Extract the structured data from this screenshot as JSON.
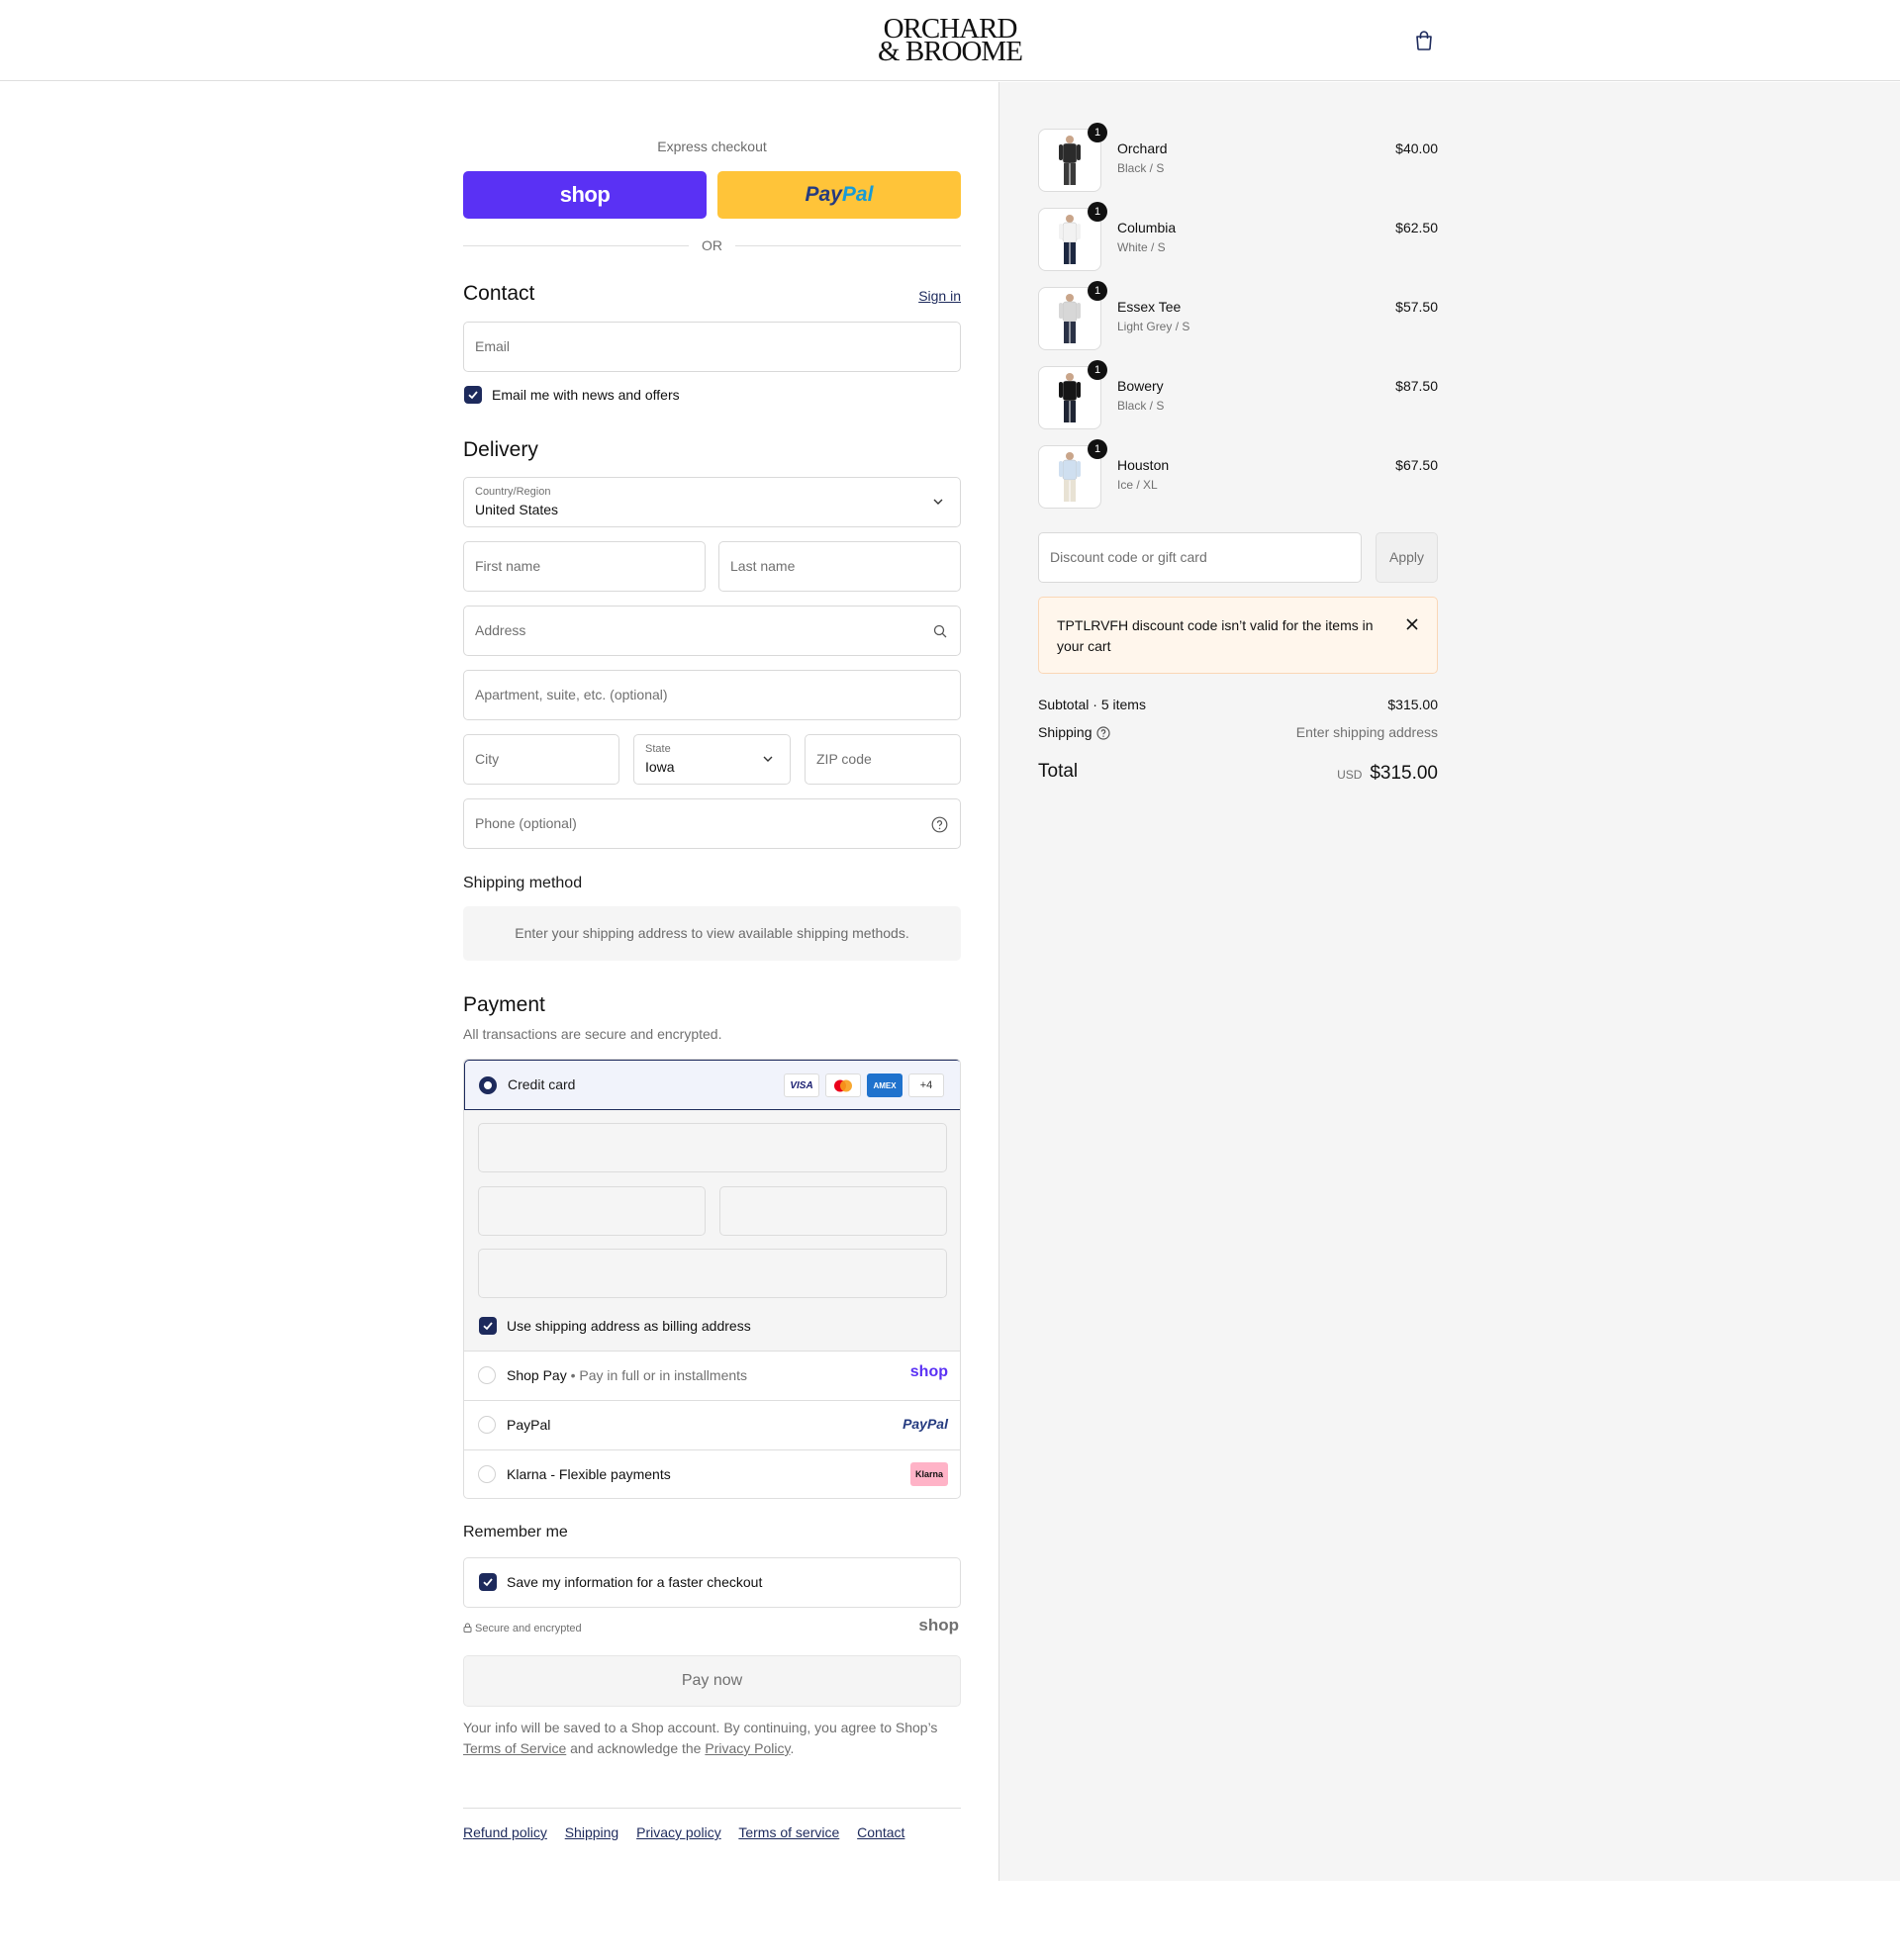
{
  "header": {
    "logo_line1": "ORCHARD",
    "logo_line2": "& BROOME",
    "cart_icon": "shopping-bag-icon"
  },
  "express": {
    "label": "Express checkout",
    "shop_label": "shop",
    "paypal_label_1": "Pay",
    "paypal_label_2": "Pal",
    "or_label": "OR"
  },
  "contact": {
    "title": "Contact",
    "sign_in": "Sign in",
    "email_placeholder": "Email",
    "news_checkbox_label": "Email me with news and offers",
    "news_checked": true
  },
  "delivery": {
    "title": "Delivery",
    "country_label": "Country/Region",
    "country_value": "United States",
    "first_name_placeholder": "First name",
    "last_name_placeholder": "Last name",
    "address_placeholder": "Address",
    "apartment_placeholder": "Apartment, suite, etc. (optional)",
    "city_placeholder": "City",
    "state_label": "State",
    "state_value": "Iowa",
    "zip_placeholder": "ZIP code",
    "phone_placeholder": "Phone (optional)"
  },
  "shipping_method": {
    "title": "Shipping method",
    "message": "Enter your shipping address to view available shipping methods."
  },
  "payment": {
    "title": "Payment",
    "subtitle": "All transactions are secure and encrypted.",
    "credit_card_label": "Credit card",
    "card_logos": [
      "VISA",
      "AMEX",
      "+4"
    ],
    "billing_checkbox_label": "Use shipping address as billing address",
    "billing_checked": true,
    "methods": [
      {
        "label": "Shop Pay",
        "sub": "Pay in full or in installments",
        "logo": "shop"
      },
      {
        "label": "PayPal",
        "sub": "",
        "logo": "PayPal"
      },
      {
        "label": "Klarna - Flexible payments",
        "sub": "",
        "logo": "Klarna"
      }
    ]
  },
  "remember": {
    "title": "Remember me",
    "checkbox_label": "Save my information for a faster checkout",
    "checked": true,
    "secure_label": "Secure and encrypted",
    "shop_logo": "shop"
  },
  "pay_now_label": "Pay now",
  "legal": {
    "text_1": "Your info will be saved to a Shop account. By continuing, you agree to Shop’s",
    "terms_link": "Terms of Service",
    "text_2": "and acknowledge the",
    "privacy_link": "Privacy Policy",
    "text_3": "."
  },
  "footer_links": [
    "Refund policy",
    "Shipping",
    "Privacy policy",
    "Terms of service",
    "Contact"
  ],
  "order": {
    "items": [
      {
        "name": "Orchard",
        "variant": "Black / S",
        "price": "$40.00",
        "qty": "1",
        "shirt": "#2b2b2b",
        "pants": "#3a3a3a"
      },
      {
        "name": "Columbia",
        "variant": "White / S",
        "price": "$62.50",
        "qty": "1",
        "shirt": "#f2f2f2",
        "pants": "#1c2740"
      },
      {
        "name": "Essex Tee",
        "variant": "Light Grey / S",
        "price": "$57.50",
        "qty": "1",
        "shirt": "#d7d7d7",
        "pants": "#2a3146"
      },
      {
        "name": "Bowery",
        "variant": "Black / S",
        "price": "$87.50",
        "qty": "1",
        "shirt": "#161616",
        "pants": "#1e2433"
      },
      {
        "name": "Houston",
        "variant": "Ice / XL",
        "price": "$67.50",
        "qty": "1",
        "shirt": "#cfdff0",
        "pants": "#e8e2d4"
      }
    ],
    "discount_placeholder": "Discount code or gift card",
    "apply_label": "Apply",
    "alert_text": "TPTLRVFH discount code isn’t valid for the items in your cart",
    "subtotal_label": "Subtotal · 5 items",
    "subtotal_value": "$315.00",
    "shipping_label": "Shipping",
    "shipping_value": "Enter shipping address",
    "total_label": "Total",
    "currency": "USD",
    "total_value": "$315.00"
  },
  "colors": {
    "accent": "#1d2a5c",
    "shop_purple": "#5a31f4",
    "paypal_yellow": "#ffc439",
    "alert_bg": "#fff6ec"
  }
}
